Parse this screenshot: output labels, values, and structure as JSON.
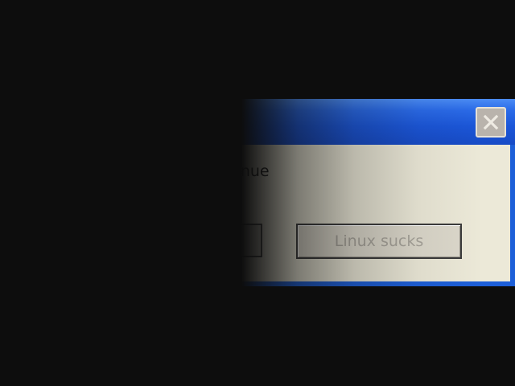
{
  "dialog": {
    "message": "continue",
    "close_icon": "close-icon",
    "buttons": {
      "hidden_label": "",
      "linux_label": "Linux sucks"
    }
  },
  "colors": {
    "titlebar": "#1d5fd8",
    "client": "#ece9d8",
    "background": "#0d0d0d"
  }
}
